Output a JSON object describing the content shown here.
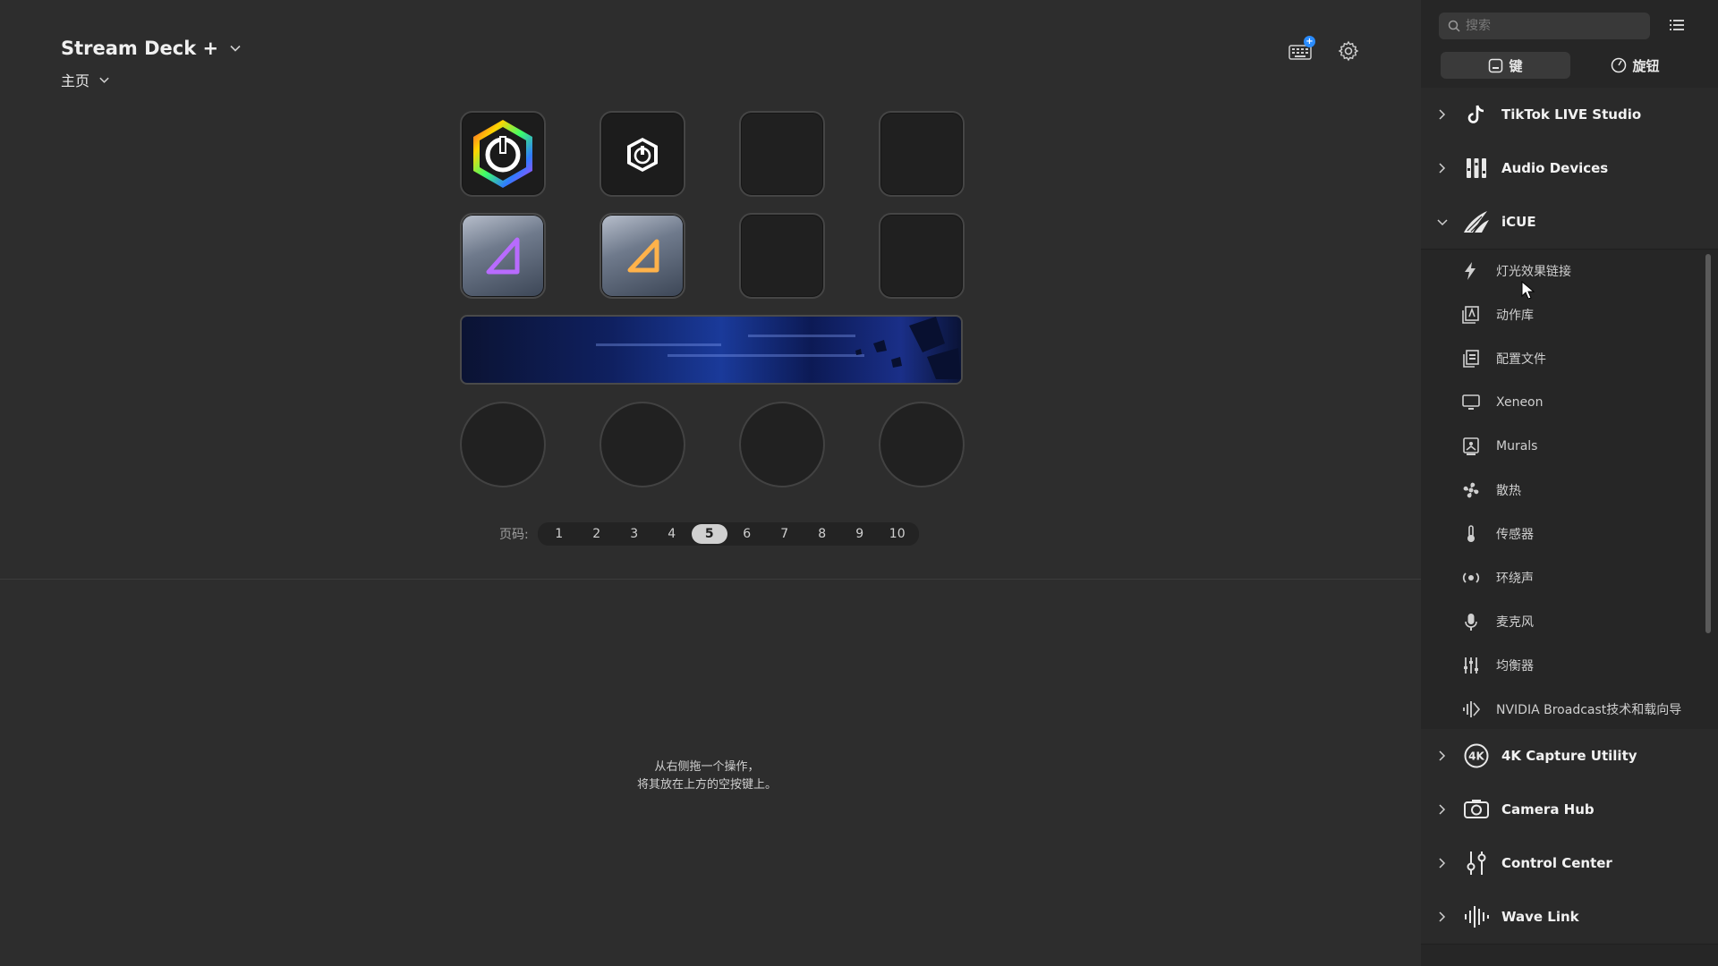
{
  "header": {
    "device_name": "Stream Deck +",
    "page_name": "主页"
  },
  "pager": {
    "label": "页码:",
    "pages": [
      "1",
      "2",
      "3",
      "4",
      "5",
      "6",
      "7",
      "8",
      "9",
      "10"
    ],
    "active": "5"
  },
  "hint": {
    "line1": "从右侧拖一个操作，",
    "line2": "将其放在上方的空按键上。"
  },
  "colors": {
    "accent": "#2a8cff",
    "background": "#2d2d2d",
    "sidebar": "#262626"
  },
  "sidebar": {
    "search_placeholder": "搜索",
    "tabs": [
      {
        "label": "键",
        "icon": "key-icon",
        "active": true
      },
      {
        "label": "旋钮",
        "icon": "dial-icon",
        "active": false
      }
    ],
    "categories": [
      {
        "label": "TikTok LIVE Studio",
        "icon": "tiktok-icon",
        "expanded": false
      },
      {
        "label": "Audio Devices",
        "icon": "audio-devices-icon",
        "expanded": false
      },
      {
        "label": "iCUE",
        "icon": "icue-icon",
        "expanded": true
      }
    ],
    "icue_items": [
      {
        "label": "灯光效果链接",
        "icon": "lightning-icon"
      },
      {
        "label": "动作库",
        "icon": "action-library-icon"
      },
      {
        "label": "配置文件",
        "icon": "profile-icon"
      },
      {
        "label": "Xeneon",
        "icon": "monitor-icon"
      },
      {
        "label": "Murals",
        "icon": "murals-icon"
      },
      {
        "label": "散热",
        "icon": "fan-icon"
      },
      {
        "label": "传感器",
        "icon": "thermometer-icon"
      },
      {
        "label": "环绕声",
        "icon": "surround-icon"
      },
      {
        "label": "麦克风",
        "icon": "microphone-icon"
      },
      {
        "label": "均衡器",
        "icon": "equalizer-icon"
      },
      {
        "label": "NVIDIA Broadcast技术和载向导",
        "icon": "nvidia-broadcast-icon"
      }
    ],
    "more_categories": [
      {
        "label": "4K Capture Utility",
        "icon": "4k-icon"
      },
      {
        "label": "Camera Hub",
        "icon": "camera-icon"
      },
      {
        "label": "Control Center",
        "icon": "control-center-icon"
      },
      {
        "label": "Wave Link",
        "icon": "wave-icon"
      }
    ]
  }
}
